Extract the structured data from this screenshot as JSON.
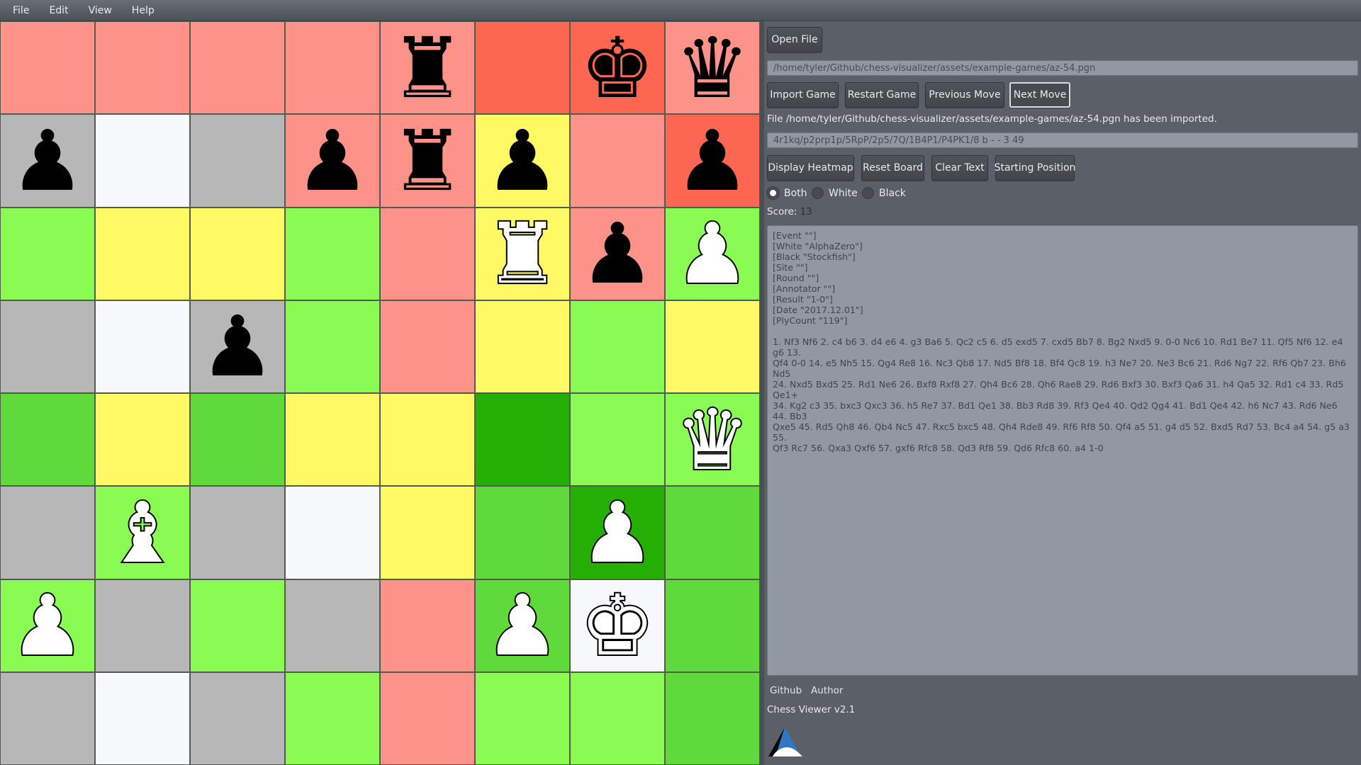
{
  "menu": [
    "File",
    "Edit",
    "View",
    "Help"
  ],
  "board": {
    "colors": {
      "salmon": "#fd9388",
      "red": "#fd6650",
      "grey": "#b7b7b7",
      "white": "#f6f8fb",
      "yellow": "#fef965",
      "light_green": "#8afb52",
      "mid_green": "#60d93a",
      "dark_green": "#25ae03"
    },
    "rows": [
      [
        "salmon",
        "salmon",
        "salmon",
        "salmon",
        "salmon",
        "red",
        "red",
        "salmon"
      ],
      [
        "grey",
        "white",
        "grey",
        "salmon",
        "salmon",
        "yellow",
        "salmon",
        "red"
      ],
      [
        "light_green",
        "yellow",
        "yellow",
        "light_green",
        "salmon",
        "yellow",
        "salmon",
        "light_green"
      ],
      [
        "grey",
        "white",
        "grey",
        "light_green",
        "salmon",
        "yellow",
        "light_green",
        "yellow"
      ],
      [
        "mid_green",
        "yellow",
        "mid_green",
        "yellow",
        "yellow",
        "dark_green",
        "light_green",
        "light_green"
      ],
      [
        "grey",
        "light_green",
        "grey",
        "white",
        "yellow",
        "mid_green",
        "dark_green",
        "mid_green"
      ],
      [
        "light_green",
        "grey",
        "light_green",
        "grey",
        "salmon",
        "mid_green",
        "white",
        "mid_green"
      ],
      [
        "grey",
        "white",
        "grey",
        "light_green",
        "salmon",
        "light_green",
        "light_green",
        "mid_green"
      ]
    ],
    "pieces": [
      [
        "",
        "",
        "",
        "",
        "r",
        "",
        "k",
        "q"
      ],
      [
        "p",
        "",
        "",
        "p",
        "r",
        "p",
        "",
        "p"
      ],
      [
        "",
        "",
        "",
        "",
        "",
        "R",
        "p",
        "P"
      ],
      [
        "",
        "",
        "p",
        "",
        "",
        "",
        "",
        ""
      ],
      [
        "",
        "",
        "",
        "",
        "",
        "",
        "",
        "Q"
      ],
      [
        "",
        "B",
        "",
        "",
        "",
        "",
        "P",
        ""
      ],
      [
        "P",
        "",
        "",
        "",
        "",
        "P",
        "K",
        ""
      ],
      [
        "",
        "",
        "",
        "",
        "",
        "",
        "",
        ""
      ]
    ],
    "glyphs": {
      "k": "♚",
      "q": "♛",
      "r": "♜",
      "b": "♝",
      "n": "♞",
      "p": "♟",
      "K": "♚",
      "Q": "♛",
      "R": "♜",
      "B": "♝",
      "N": "♞",
      "P": "♟"
    }
  },
  "panel": {
    "open_file_label": "Open File",
    "file_path": "/home/tyler/Github/chess-visualizer/assets/example-games/az-54.pgn",
    "import_game_label": "Import Game",
    "restart_game_label": "Restart Game",
    "previous_move_label": "Previous Move",
    "next_move_label": "Next Move",
    "status_message": "File /home/tyler/Github/chess-visualizer/assets/example-games/az-54.pgn has been imported.",
    "fen": "4r1kq/p2prp1p/5RpP/2p5/7Q/1B4P1/P4PK1/8 b - - 3 49",
    "display_heatmap_label": "Display Heatmap",
    "reset_board_label": "Reset Board",
    "clear_text_label": "Clear Text",
    "starting_position_label": "Starting Position",
    "radio": {
      "selected": "Both",
      "options": [
        "Both",
        "White",
        "Black"
      ]
    },
    "score_label": "Score:",
    "score_value": "13",
    "pgn_text": "[Event \"\"]\n[White \"AlphaZero\"]\n[Black \"Stockfish\"]\n[Site \"\"]\n[Round \"\"]\n[Annotator \"\"]\n[Result \"1-0\"]\n[Date \"2017.12.01\"]\n[PlyCount \"119\"]\n\n1. Nf3 Nf6 2. c4 b6 3. d4 e6 4. g3 Ba6 5. Qc2 c5 6. d5 exd5 7. cxd5 Bb7 8. Bg2 Nxd5 9. 0-0 Nc6 10. Rd1 Be7 11. Qf5 Nf6 12. e4 g6 13.\nQf4 0-0 14. e5 Nh5 15. Qg4 Re8 16. Nc3 Qb8 17. Nd5 Bf8 18. Bf4 Qc8 19. h3 Ne7 20. Ne3 Bc6 21. Rd6 Ng7 22. Rf6 Qb7 23. Bh6 Nd5\n24. Nxd5 Bxd5 25. Rd1 Ne6 26. Bxf8 Rxf8 27. Qh4 Bc6 28. Qh6 Rae8 29. Rd6 Bxf3 30. Bxf3 Qa6 31. h4 Qa5 32. Rd1 c4 33. Rd5 Qe1+\n34. Kg2 c3 35. bxc3 Qxc3 36. h5 Re7 37. Bd1 Qe1 38. Bb3 Rd8 39. Rf3 Qe4 40. Qd2 Qg4 41. Bd1 Qe4 42. h6 Nc7 43. Rd6 Ne6 44. Bb3\nQxe5 45. Rd5 Qh8 46. Qb4 Nc5 47. Rxc5 bxc5 48. Qh4 Rde8 49. Rf6 Rf8 50. Qf4 a5 51. g4 d5 52. Bxd5 Rd7 53. Bc4 a4 54. g5 a3 55.\nQf3 Rc7 56. Qxa3 Qxf6 57. gxf6 Rfc8 58. Qd3 Rf8 59. Qd6 Rfc8 60. a4 1-0",
    "github_link": "Github",
    "author_link": "Author",
    "version": "Chess Viewer v2.1"
  }
}
